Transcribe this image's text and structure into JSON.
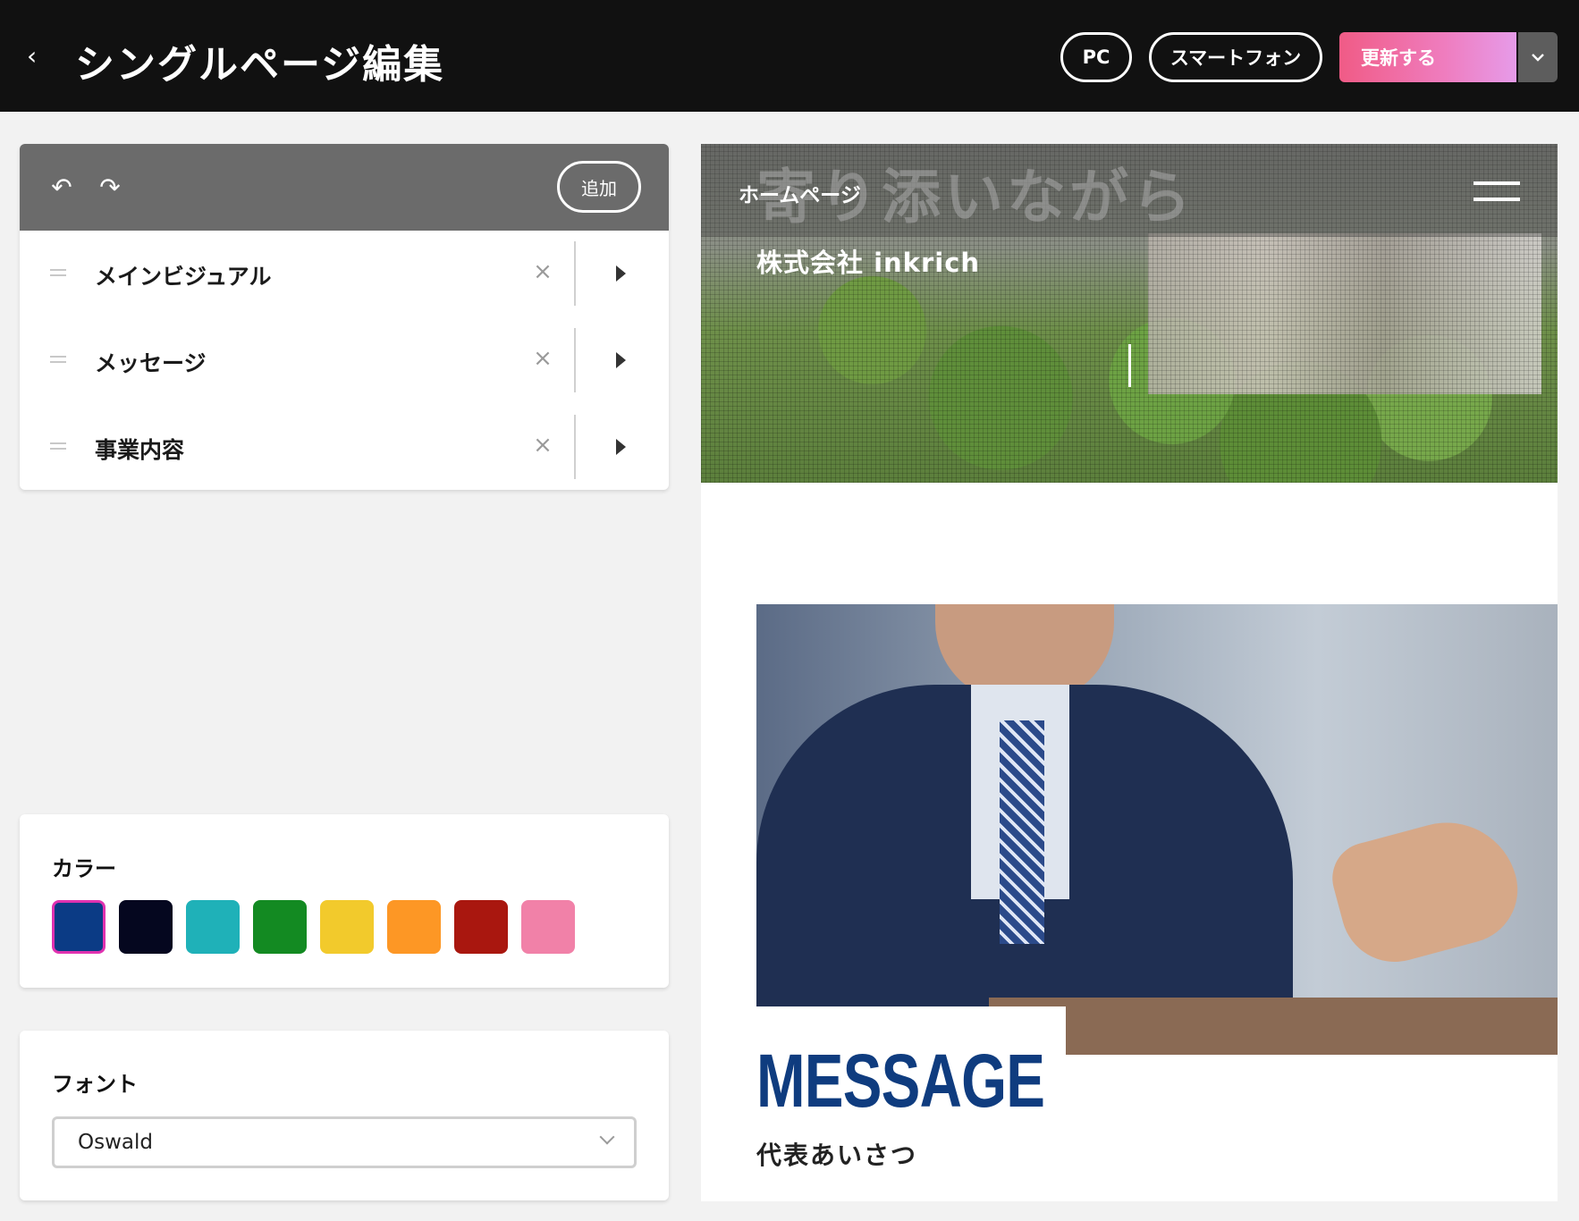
{
  "header": {
    "back_icon": "chevron-left-icon",
    "title": "シングルページ編集",
    "pc_label": "PC",
    "smartphone_label": "スマートフォン",
    "update_label": "更新する",
    "update_colors": [
      "#f05b86",
      "#e69be9"
    ]
  },
  "sections_panel": {
    "undo_icon": "undo-icon",
    "redo_icon": "redo-icon",
    "add_label": "追加",
    "items": [
      {
        "label": "メインビジュアル"
      },
      {
        "label": "メッセージ"
      },
      {
        "label": "事業内容"
      }
    ]
  },
  "color_panel": {
    "title": "カラー",
    "swatches": [
      "#0b3b85",
      "#05071f",
      "#1fb1b8",
      "#138a22",
      "#f2ca2c",
      "#fd9725",
      "#a9170f",
      "#f181a8"
    ],
    "selected_index": 0,
    "selected_border": "#e032b0"
  },
  "font_panel": {
    "title": "フォント",
    "selected": "Oswald"
  },
  "preview": {
    "hero_overlay_text": "寄り添いながら",
    "home_label": "ホームページ",
    "company": "株式会社 inkrich",
    "message_heading": "MESSAGE",
    "message_sub": "代表あいさつ",
    "accent": "#0f3c7f"
  }
}
